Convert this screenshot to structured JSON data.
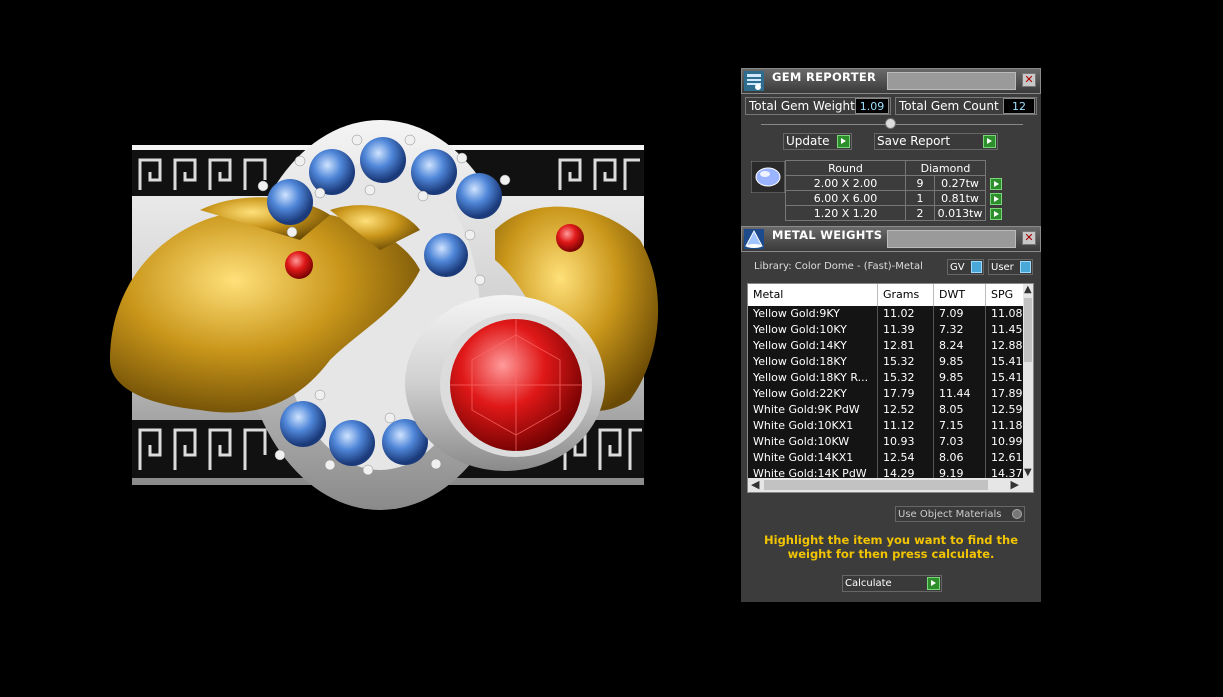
{
  "gem_reporter": {
    "title": "GEM REPORTER",
    "total_gem_weight_label": "Total Gem Weight",
    "total_gem_weight_value": "1.09",
    "total_gem_count_label": "Total Gem Count",
    "total_gem_count_value": "12",
    "update_label": "Update",
    "save_report_label": "Save Report",
    "table_header": {
      "shape": "Round",
      "material": "Diamond"
    },
    "rows": [
      {
        "size": "2.00 X 2.00",
        "count": "9",
        "weight": "0.27tw"
      },
      {
        "size": "6.00 X 6.00",
        "count": "1",
        "weight": "0.81tw"
      },
      {
        "size": "1.20 X 1.20",
        "count": "2",
        "weight": "0.013tw"
      }
    ]
  },
  "metal_weights": {
    "title": "METAL WEIGHTS",
    "library_label": "Library: Color Dome - (Fast)-Metal",
    "gv_label": "GV",
    "user_label": "User",
    "columns": [
      "Metal",
      "Grams",
      "DWT",
      "SPG"
    ],
    "rows": [
      {
        "metal": "Yellow Gold:9KY",
        "grams": "11.02",
        "dwt": "7.09",
        "spg": "11.08"
      },
      {
        "metal": "Yellow Gold:10KY",
        "grams": "11.39",
        "dwt": "7.32",
        "spg": "11.45"
      },
      {
        "metal": "Yellow Gold:14KY",
        "grams": "12.81",
        "dwt": "8.24",
        "spg": "12.88"
      },
      {
        "metal": "Yellow Gold:18KY",
        "grams": "15.32",
        "dwt": "9.85",
        "spg": "15.41"
      },
      {
        "metal": "Yellow Gold:18KY R...",
        "grams": "15.32",
        "dwt": "9.85",
        "spg": "15.41"
      },
      {
        "metal": "Yellow Gold:22KY",
        "grams": "17.79",
        "dwt": "11.44",
        "spg": "17.89"
      },
      {
        "metal": "White Gold:9K PdW",
        "grams": "12.52",
        "dwt": "8.05",
        "spg": "12.59"
      },
      {
        "metal": "White Gold:10KX1",
        "grams": "11.12",
        "dwt": "7.15",
        "spg": "11.18"
      },
      {
        "metal": "White Gold:10KW",
        "grams": "10.93",
        "dwt": "7.03",
        "spg": "10.99"
      },
      {
        "metal": "White Gold:14KX1",
        "grams": "12.54",
        "dwt": "8.06",
        "spg": "12.61"
      },
      {
        "metal": "White Gold:14K PdW",
        "grams": "14.29",
        "dwt": "9.19",
        "spg": "14.37"
      }
    ],
    "use_object_materials_label": "Use Object Materials",
    "hint_text": "Highlight the item you want to find the weight for then press calculate.",
    "calculate_label": "Calculate"
  },
  "colors": {
    "hint": "#f2c400",
    "accent_green": "#2c8f2c",
    "number_text": "#9ae0ff"
  }
}
